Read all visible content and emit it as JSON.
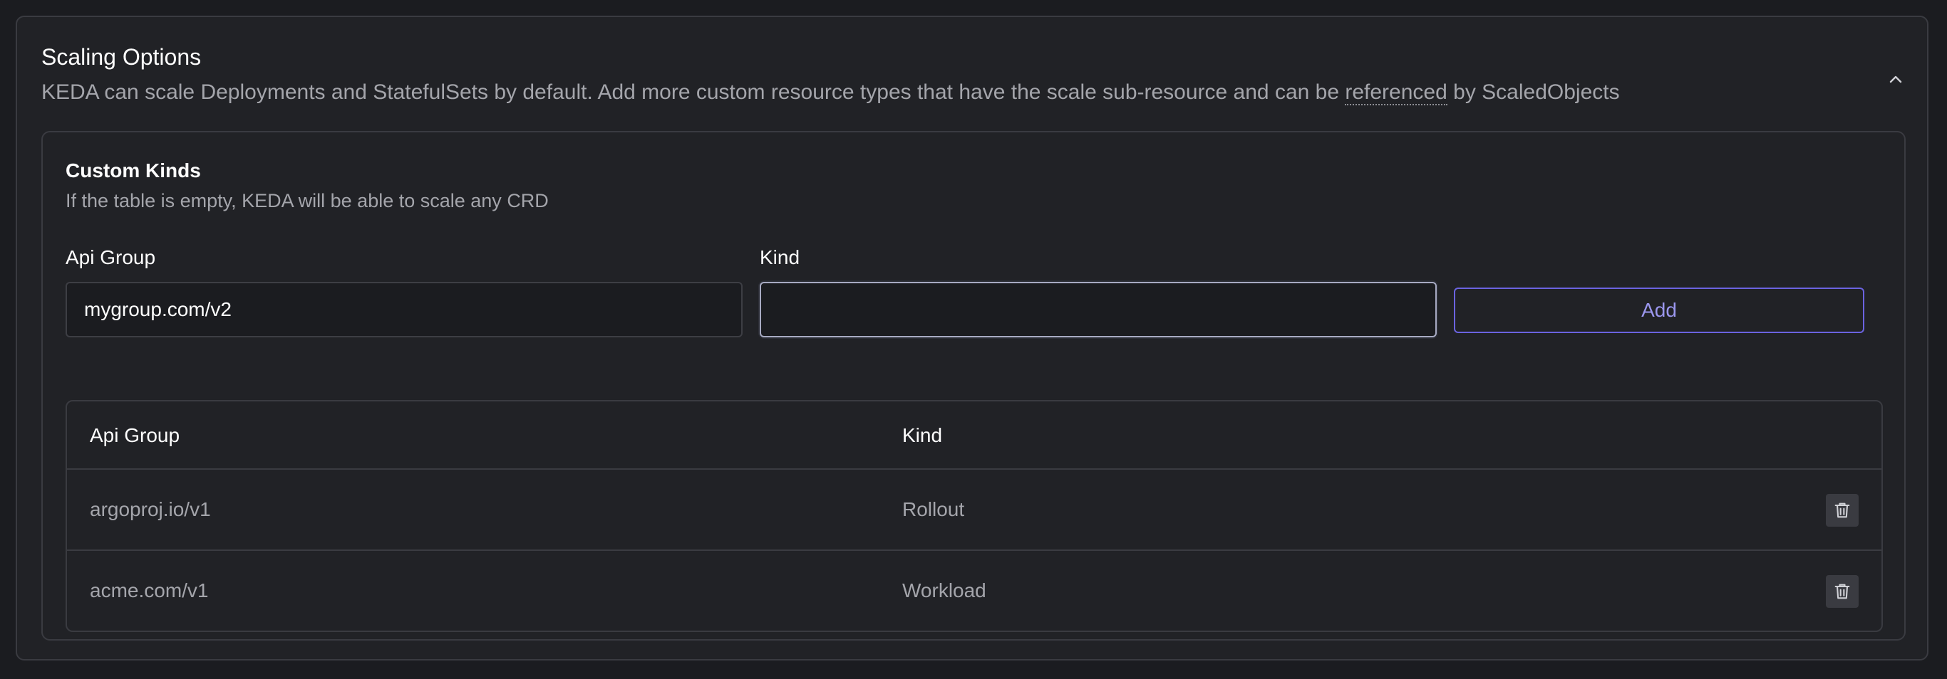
{
  "section": {
    "title": "Scaling Options",
    "description_before": "KEDA can scale Deployments and StatefulSets by default. Add more custom resource types that have the scale sub-resource and can be ",
    "description_link": "referenced",
    "description_after": " by ScaledObjects"
  },
  "custom_kinds": {
    "title": "Custom Kinds",
    "description": "If the table is empty, KEDA will be able to scale any CRD",
    "api_group_label": "Api Group",
    "api_group_value": "mygroup.com/v2",
    "kind_label": "Kind",
    "kind_value": "",
    "add_label": "Add"
  },
  "table": {
    "headers": [
      "Api Group",
      "Kind"
    ],
    "rows": [
      {
        "api_group": "argoproj.io/v1",
        "kind": "Rollout"
      },
      {
        "api_group": "acme.com/v1",
        "kind": "Workload"
      }
    ]
  },
  "icons": {
    "collapse": "chevron-up-icon",
    "delete": "trash-icon"
  },
  "colors": {
    "background": "#1b1c20",
    "panel": "#212226",
    "border": "#3a3b41",
    "accent": "#6b63e0",
    "muted_text": "#a4a5ab"
  }
}
